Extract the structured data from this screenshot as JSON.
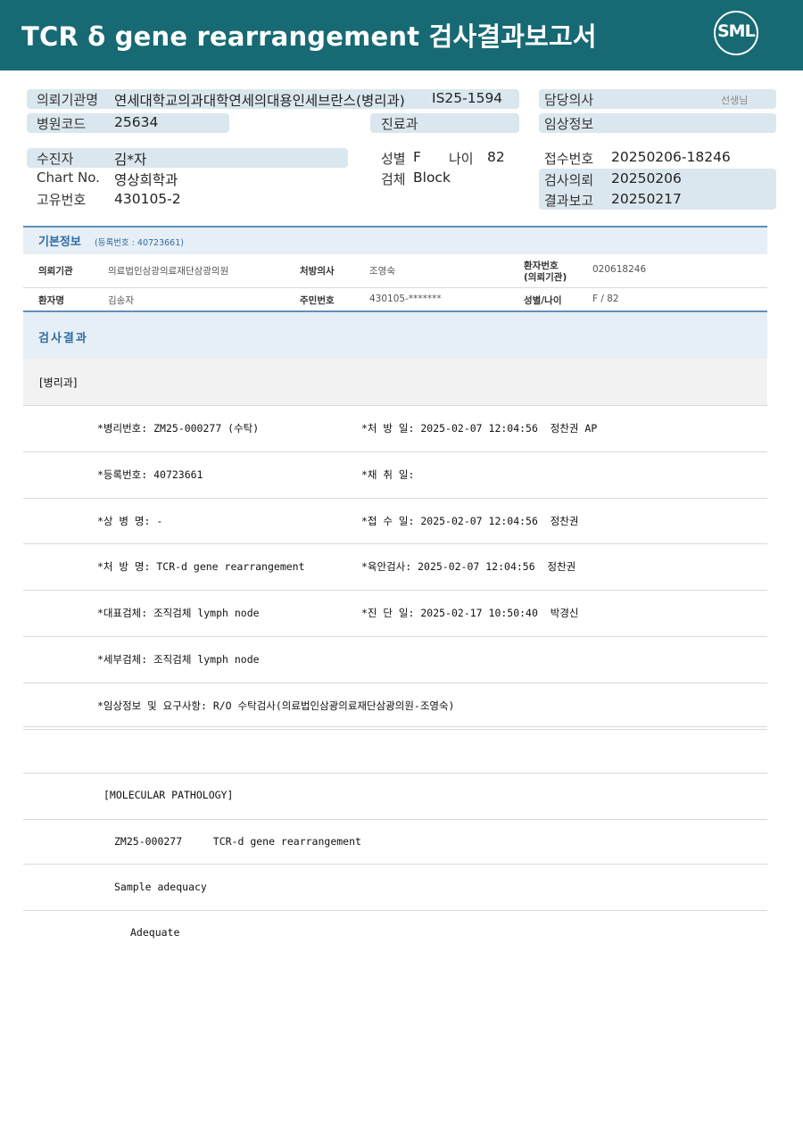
{
  "title": "TCR δ gene rearrangement 검사결과보고서",
  "logo_text": "SML",
  "top": {
    "inst_label": "의뢰기관명",
    "inst_value": "연세대학교의과대학연세의대용인세브란스(병리과)",
    "inst_code": "IS25-1594",
    "doctor_label": "담당의사",
    "doctor_suffix": "선생님",
    "hosp_code_label": "병원코드",
    "hosp_code": "25634",
    "dept_label": "진료과",
    "clinical_label": "임상정보",
    "patient_label": "수진자",
    "patient_name": "김*자",
    "sex_label": "성별",
    "sex": "F",
    "age_label": "나이",
    "age": "82",
    "receipt_label": "접수번호",
    "receipt": "20250206-18246",
    "chart_label": "Chart No.",
    "chart": "영상희학과",
    "specimen_label": "검체",
    "specimen": "Block",
    "req_label": "검사의뢰",
    "req": "20250206",
    "uid_label": "고유번호",
    "uid": "430105-2",
    "report_label": "결과보고",
    "report": "20250217"
  },
  "basic": {
    "title": "기본정보",
    "reg": "(등록번호 : 40723661)",
    "inst_k": "의뢰기관",
    "inst_v": "의료법인삼광의료재단삼광의원",
    "presc_k": "처방의사",
    "presc_v": "조영숙",
    "ptno_k1": "환자번호",
    "ptno_k2": "(의뢰기관)",
    "ptno_v": "020618246",
    "name_k": "환자명",
    "name_v": "김송자",
    "rrn_k": "주민번호",
    "rrn_v": "430105-*******",
    "sexage_k": "성별/나이",
    "sexage_v": "F / 82"
  },
  "results": {
    "title": "검사결과",
    "dept": "[병리과]",
    "rows": [
      {
        "left": "*병리번호: ZM25-000277 (수탁)",
        "right": "*처 방 일: 2025-02-07 12:04:56  정찬권 AP"
      },
      {
        "left": "*등록번호: 40723661",
        "right": "*채 취 일:"
      },
      {
        "left": "*상 병 명: -",
        "right": "*접 수 일: 2025-02-07 12:04:56  정찬권"
      },
      {
        "left": "*처 방 명: TCR-d gene rearrangement",
        "right": "*육안검사: 2025-02-07 12:04:56  정찬권"
      },
      {
        "left": "*대표검체: 조직검체 lymph node",
        "right": "*진 단 일: 2025-02-17 10:50:40  박경신"
      },
      {
        "left": "*세부검체: 조직검체 lymph node",
        "right": ""
      },
      {
        "left": "*임상정보 및 요구사항: R/O 수탁검사(의료법인삼광의료재단삼광의원-조영숙)",
        "right": ""
      }
    ],
    "molecular_title": "[MOLECULAR PATHOLOGY]",
    "molecular_line": "ZM25-000277     TCR-d gene rearrangement",
    "adequacy_label": "Sample adequacy",
    "adequacy_value": "Adequate"
  }
}
